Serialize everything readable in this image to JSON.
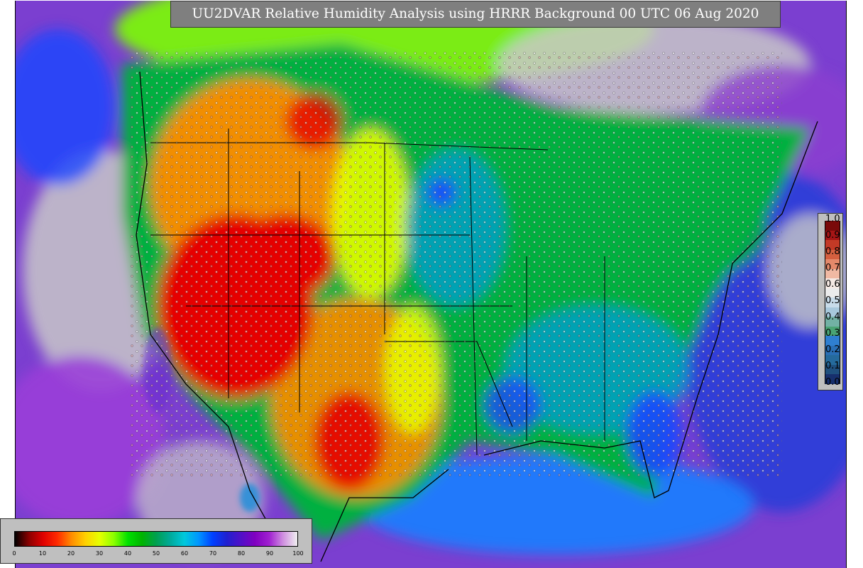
{
  "title": "UU2DVAR Relative Humidity Analysis using HRRR Background 00 UTC 06 Aug 2020",
  "observation_scale": {
    "labels": [
      "1.0",
      "0.9",
      "0.8",
      "0.7",
      "0.6",
      "0.5",
      "0.4",
      "0.3",
      "0.2",
      "0.1",
      "0.0"
    ],
    "colors": [
      "#7a0a0a",
      "#a51515",
      "#c33a26",
      "#d5603f",
      "#e4896a",
      "#f0b9a3",
      "#f5e9e4",
      "#ebebeb",
      "#c8dcea",
      "#a7c8dc",
      "#72b1a4",
      "#4aa474",
      "#2f7fd0",
      "#2a6fb5",
      "#256a9c",
      "#1f4f7e",
      "#172f6d"
    ]
  },
  "colorbar": {
    "ticks": [
      "0",
      "10",
      "20",
      "30",
      "40",
      "50",
      "60",
      "70",
      "80",
      "90",
      "100"
    ],
    "stops": [
      "#000000",
      "#8b0000",
      "#e00000",
      "#ff2a00",
      "#ff8c00",
      "#ffd000",
      "#e6ff00",
      "#8cff00",
      "#00e000",
      "#00b400",
      "#00a050",
      "#00aa9a",
      "#00c8dc",
      "#0096ff",
      "#0040ff",
      "#2020d0",
      "#5010c8",
      "#8000c0",
      "#a020d0",
      "#d090e0",
      "#f0f0f0"
    ]
  },
  "map": {
    "ocean_color": "#7b3fd0",
    "land_background": "#00a830",
    "regions": {
      "dry_west": "#e60000",
      "semi_arid": "#ff8c00",
      "plains_yellow": "#e6ff00",
      "humid_east": "#00a0c8",
      "very_humid": "#1a48ff",
      "saturated": "#c8c8c8"
    }
  }
}
